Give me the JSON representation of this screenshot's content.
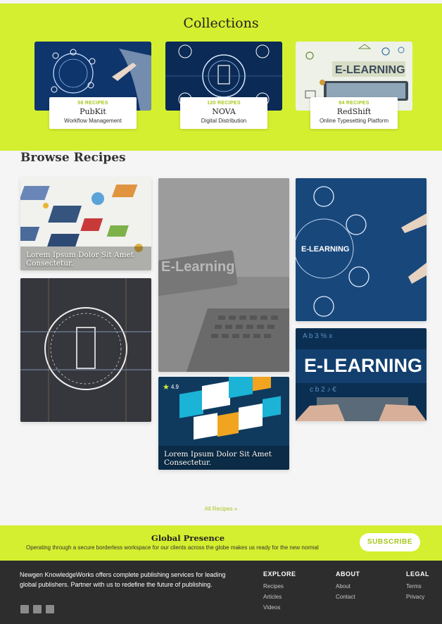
{
  "collections": {
    "title": "Collections",
    "cards": [
      {
        "count": "56 RECIPES",
        "name": "PubKit",
        "subtitle": "Workflow Management"
      },
      {
        "count": "120 RECIPES",
        "name": "NOVA",
        "subtitle": "Digital Distribution"
      },
      {
        "count": "94 RECIPES",
        "name": "RedShift",
        "subtitle": "Online Typesetting Platform"
      }
    ]
  },
  "browse": {
    "title": "Browse Recipes",
    "tiles": [
      {
        "caption": "Lorem Ipsum Dolor Sit Amet Consectetur."
      },
      {
        "caption": ""
      },
      {
        "caption": ""
      },
      {
        "caption": ""
      },
      {
        "caption": "Lorem Ipsum Dolor Sit Amet Consectetur.",
        "rating": "4.9"
      },
      {
        "caption": ""
      }
    ],
    "all_label": "All Recipes »"
  },
  "global": {
    "title": "Global Presence",
    "text": "Operating through a secure borderless workspace for our clients across the globe makes us ready for the new normal",
    "subscribe_label": "SUBSCRIBE"
  },
  "footer": {
    "description": "Newgen KnowledgeWorks offers complete publishing services for leading global publishers. Partner with us to redefine the future of publishing.",
    "explore": {
      "heading": "EXPLORE",
      "links": [
        "Recipes",
        "Articles",
        "Videos"
      ]
    },
    "about": {
      "heading": "ABOUT",
      "links": [
        "About",
        "Contact"
      ]
    },
    "legal": {
      "heading": "LEGAL",
      "links": [
        "Terms",
        "Privacy"
      ]
    }
  },
  "colors": {
    "accent": "#d4ef2f",
    "accent_text": "#a6c61a",
    "footer_bg": "#2d2d2d"
  }
}
